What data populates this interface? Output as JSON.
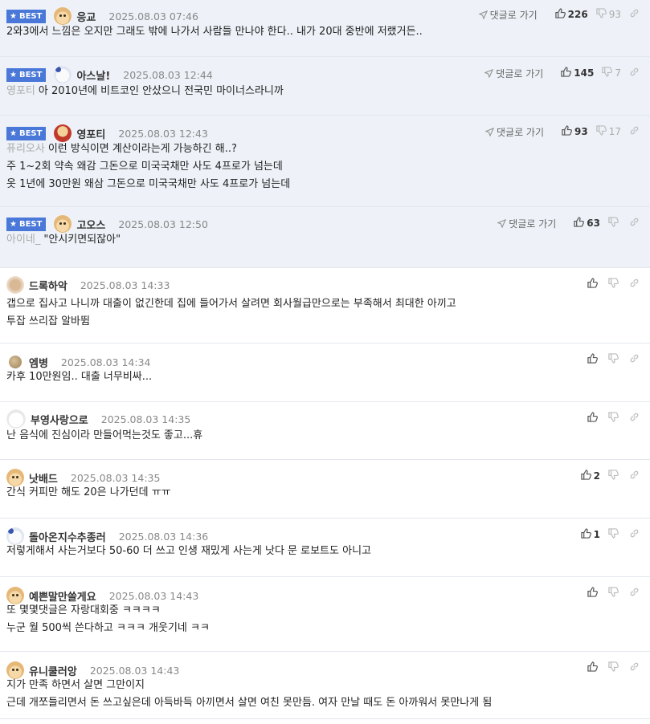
{
  "labels": {
    "best": "BEST",
    "goto_reply": "댓글로 가기"
  },
  "comments": [
    {
      "best": true,
      "avatar": "dog",
      "nick": "응교",
      "date": "2025.08.03 07:46",
      "likes": "226",
      "dislikes": "93",
      "lines": [
        {
          "ref": "",
          "text": "2와3에서 느낌은 오지만 그래도 밖에 나가서 사람들 만나야 한다.. 내가 20대 중반에 저랬거든.."
        }
      ]
    },
    {
      "best": true,
      "avatar": "bear",
      "nick": "아스날!",
      "date": "2025.08.03 12:44",
      "likes": "145",
      "dislikes": "7",
      "lines": [
        {
          "ref": "영포티",
          "text": "아 2010년에 비트코인 안샀으니 전국민 마이너스라니까"
        }
      ]
    },
    {
      "best": true,
      "avatar": "redog",
      "nick": "영포티",
      "date": "2025.08.03 12:43",
      "likes": "93",
      "dislikes": "17",
      "lines": [
        {
          "ref": "퓨리오사",
          "text": "이런 방식이면 계산이라는게 가능하긴 해..?"
        },
        {
          "ref": "",
          "text": "주 1~2회 약속 왜감 그돈으로 미국국채만 사도 4프로가 넘는데"
        },
        {
          "ref": "",
          "text": "옷 1년에 30만원 왜삼 그돈으로 미국국채만 사도 4프로가 넘는데"
        }
      ]
    },
    {
      "best": true,
      "avatar": "dog",
      "nick": "고오스",
      "date": "2025.08.03 12:50",
      "likes": "63",
      "dislikes": "",
      "lines": [
        {
          "ref": "아이네_",
          "text": "\"안시키면되잖아\""
        }
      ]
    },
    {
      "best": false,
      "avatar": "blur",
      "nick": "드록하악",
      "date": "2025.08.03 14:33",
      "likes": "",
      "dislikes": "",
      "lines": [
        {
          "ref": "",
          "text": "갭으로 집사고 나니까 대출이 없긴한데 집에 들어가서 살려면 회사월급만으로는 부족해서 최대한 아끼고"
        },
        {
          "ref": "",
          "text": "투잡 쓰리잡 알바뜀"
        }
      ]
    },
    {
      "best": false,
      "avatar": "ball",
      "nick": "엠병",
      "date": "2025.08.03 14:34",
      "likes": "",
      "dislikes": "",
      "lines": [
        {
          "ref": "",
          "text": "카후 10만원임.. 대출 너무비싸..."
        }
      ]
    },
    {
      "best": false,
      "avatar": "white",
      "nick": "부영사랑으로",
      "date": "2025.08.03 14:35",
      "likes": "",
      "dislikes": "",
      "lines": [
        {
          "ref": "",
          "text": "난 음식에 진심이라 만들어먹는것도 좋고...휴"
        }
      ]
    },
    {
      "best": false,
      "avatar": "dog",
      "nick": "낫배드",
      "date": "2025.08.03 14:35",
      "likes": "2",
      "dislikes": "",
      "lines": [
        {
          "ref": "",
          "text": "간식 커피만 해도 20은 나가던데 ㅠㅠ"
        }
      ]
    },
    {
      "best": false,
      "avatar": "bear",
      "nick": "돌아온지수추종러",
      "date": "2025.08.03 14:36",
      "likes": "1",
      "dislikes": "",
      "lines": [
        {
          "ref": "",
          "text": "저렇게해서 사는거보다 50-60 더 쓰고 인생 재밌게 사는게 낫다 문 로보트도 아니고"
        }
      ]
    },
    {
      "best": false,
      "avatar": "dog",
      "nick": "예쁜말만쓸게요",
      "date": "2025.08.03 14:43",
      "likes": "",
      "dislikes": "",
      "lines": [
        {
          "ref": "",
          "text": "또 몇몇댓글은 자랑대회중 ㅋㅋㅋㅋ"
        },
        {
          "ref": "",
          "text": "누군 월 500씩 쓴다하고 ㅋㅋㅋ 개웃기네 ㅋㅋ"
        }
      ]
    },
    {
      "best": false,
      "avatar": "dog",
      "nick": "유니쿨러앙",
      "date": "2025.08.03 14:43",
      "likes": "",
      "dislikes": "",
      "lines": [
        {
          "ref": "",
          "text": "지가 만족 하면서 살면 그만이지"
        },
        {
          "ref": "",
          "text": "근데 개쪼들리면서 돈 쓰고싶은데 아득바득 아끼면서 살면 여친 못만듬. 여자 만날 때도 돈 아까워서 못만나게 됨"
        }
      ]
    }
  ]
}
